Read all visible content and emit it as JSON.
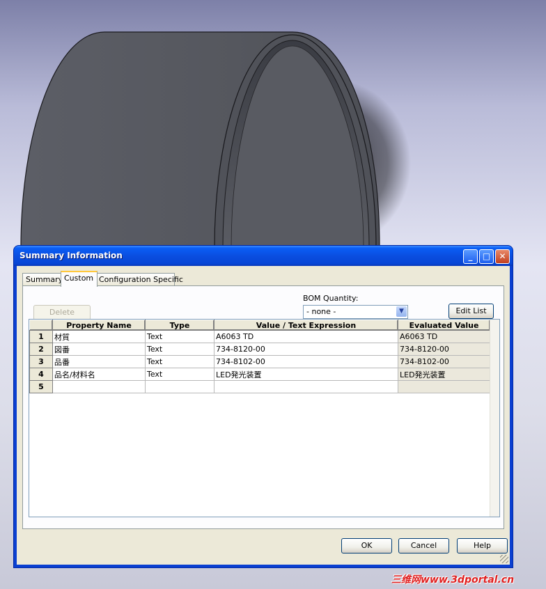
{
  "dialog": {
    "title": "Summary Information",
    "tabs": [
      "Summary",
      "Custom",
      "Configuration Specific"
    ],
    "active_tab": "Custom",
    "delete_label": "Delete",
    "bom_label": "BOM Quantity:",
    "bom_value": "- none -",
    "edit_list_label": "Edit List",
    "ok_label": "OK",
    "cancel_label": "Cancel",
    "help_label": "Help"
  },
  "grid": {
    "columns": [
      "Property Name",
      "Type",
      "Value / Text Expression",
      "Evaluated Value"
    ],
    "rows": [
      {
        "num": "1",
        "name": "材質",
        "type": "Text",
        "value": "A6063 TD",
        "evaluated": "A6063 TD"
      },
      {
        "num": "2",
        "name": "図番",
        "type": "Text",
        "value": "734-8120-00",
        "evaluated": "734-8120-00"
      },
      {
        "num": "3",
        "name": "品番",
        "type": "Text",
        "value": "734-8102-00",
        "evaluated": "734-8102-00"
      },
      {
        "num": "4",
        "name": "品名/材料名",
        "type": "Text",
        "value": "LED発光装置",
        "evaluated": "LED発光装置"
      },
      {
        "num": "5",
        "name": "",
        "type": "",
        "value": "",
        "evaluated": ""
      }
    ]
  },
  "watermark": "三维网www.3dportal.cn",
  "colors": {
    "titlebar": "#0a4ee0",
    "dialog_face": "#ece9d8",
    "model_gray": "#55575e"
  }
}
